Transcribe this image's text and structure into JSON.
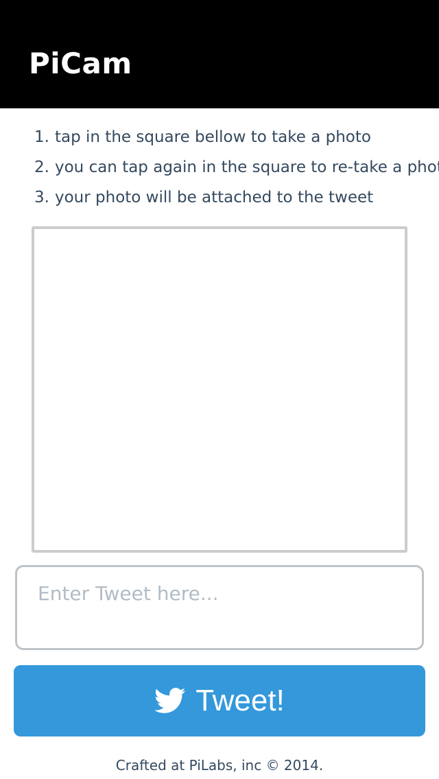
{
  "header": {
    "title": "PiCam"
  },
  "instructions": [
    {
      "num": "1.",
      "text": "tap in the square bellow to take a photo"
    },
    {
      "num": "2.",
      "text": "you can tap again in the square to re-take a photo"
    },
    {
      "num": "3.",
      "text": "your photo will be attached to the tweet"
    }
  ],
  "tweet_input": {
    "placeholder": "Enter Tweet here...",
    "value": ""
  },
  "tweet_button": {
    "label": "Tweet!",
    "icon": "twitter-bird-icon"
  },
  "footer": {
    "text": "Crafted at PiLabs, inc © 2014."
  },
  "colors": {
    "header_bg": "#000000",
    "accent": "#3498db",
    "text": "#34495e",
    "border": "#cccccc"
  }
}
